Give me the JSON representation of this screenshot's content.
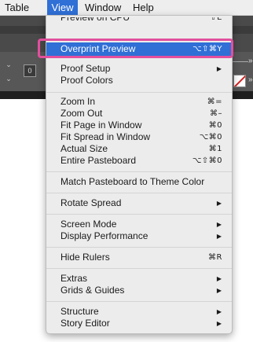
{
  "menubar": {
    "items": [
      "Table",
      "View",
      "Window",
      "Help"
    ],
    "active": "View"
  },
  "app": {
    "left_stepper": "⌄",
    "left_value": "0",
    "right_glyph_1": "»",
    "right_glyph_2": "»"
  },
  "menu": {
    "top_clipped": {
      "label": "Preview on CPU",
      "shortcut": "⇧E"
    },
    "overprint_preview": {
      "label": "Overprint Preview",
      "shortcut": "⌥⇧⌘Y"
    },
    "proof_setup": {
      "label": "Proof Setup"
    },
    "proof_colors": {
      "label": "Proof Colors"
    },
    "zoom_in": {
      "label": "Zoom In",
      "shortcut": "⌘="
    },
    "zoom_out": {
      "label": "Zoom Out",
      "shortcut": "⌘–"
    },
    "fit_page": {
      "label": "Fit Page in Window",
      "shortcut": "⌘0"
    },
    "fit_spread": {
      "label": "Fit Spread in Window",
      "shortcut": "⌥⌘0"
    },
    "actual_size": {
      "label": "Actual Size",
      "shortcut": "⌘1"
    },
    "entire_pasteboard": {
      "label": "Entire Pasteboard",
      "shortcut": "⌥⇧⌘0"
    },
    "match_pasteboard": {
      "label": "Match Pasteboard to Theme Color"
    },
    "rotate_spread": {
      "label": "Rotate Spread"
    },
    "screen_mode": {
      "label": "Screen Mode"
    },
    "display_performance": {
      "label": "Display Performance"
    },
    "hide_rulers": {
      "label": "Hide Rulers",
      "shortcut": "⌘R"
    },
    "extras": {
      "label": "Extras"
    },
    "grids_guides": {
      "label": "Grids & Guides"
    },
    "structure": {
      "label": "Structure"
    },
    "story_editor": {
      "label": "Story Editor"
    },
    "submenu_arrow": "▶"
  },
  "colors": {
    "highlight": "#2f6fd6",
    "callout": "#e24f9d",
    "menu_bg": "#ececec"
  }
}
